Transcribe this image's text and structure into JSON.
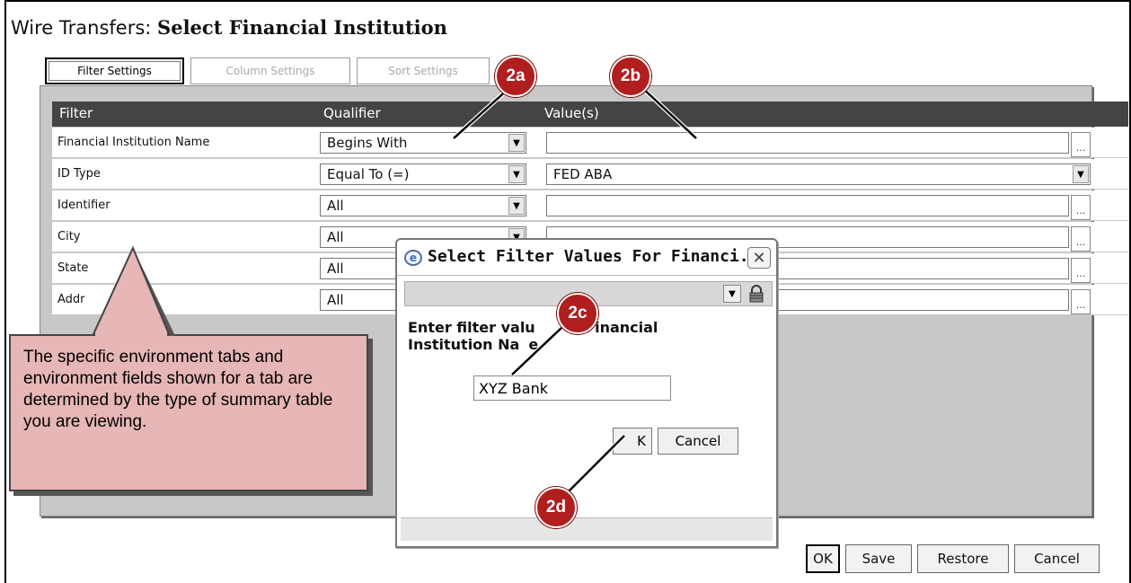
{
  "page": {
    "title_prefix": "Wire Transfers: ",
    "title_bold": "Select Financial Institution"
  },
  "tabs": [
    {
      "label": "Filter Settings",
      "active": true
    },
    {
      "label": "Column Settings",
      "active": false
    },
    {
      "label": "Sort Settings",
      "active": false
    }
  ],
  "grid": {
    "headers": {
      "filter": "Filter",
      "qualifier": "Qualifier",
      "values": "Value(s)"
    },
    "rows": [
      {
        "filter": "Financial Institution Name",
        "qualifier": "Begins With",
        "value": ""
      },
      {
        "filter": "ID Type",
        "qualifier": "Equal To (=)",
        "value": "FED ABA"
      },
      {
        "filter": "Identifier",
        "qualifier": "All",
        "value": ""
      },
      {
        "filter": "City",
        "qualifier": "All",
        "value": ""
      },
      {
        "filter": "State",
        "qualifier": "All",
        "value": ""
      },
      {
        "filter": "Addr",
        "qualifier": "All",
        "value": ""
      }
    ],
    "lookup_label": "..."
  },
  "dialog": {
    "title": "Select Filter Values For Financi...",
    "prompt_line1": "Enter filter valu",
    "prompt_line1_tail": "r Financial",
    "prompt_line2": "Institution Na",
    "prompt_line2_tail": "e",
    "input_value": "XYZ Bank",
    "ok_label": "OK",
    "ok_visible": "K",
    "cancel_label": "Cancel"
  },
  "buttons": {
    "ok": "OK",
    "save": "Save",
    "restore": "Restore",
    "cancel": "Cancel"
  },
  "callout": {
    "text": "The specific environment tabs and environment fields shown for a tab are determined by the type of summary table you are viewing."
  },
  "badges": {
    "b2a": "2a",
    "b2b": "2b",
    "b2c": "2c",
    "b2d": "2d"
  },
  "colors": {
    "header_bg": "#444444",
    "panel_bg": "#c8c8c8",
    "badge": "#b01e1e",
    "callout": "#e7b6b6"
  }
}
